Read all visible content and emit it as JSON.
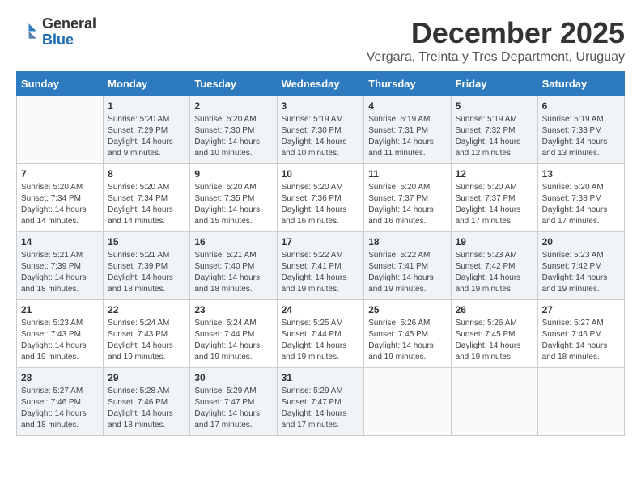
{
  "header": {
    "logo_general": "General",
    "logo_blue": "Blue",
    "month_title": "December 2025",
    "location": "Vergara, Treinta y Tres Department, Uruguay"
  },
  "weekdays": [
    "Sunday",
    "Monday",
    "Tuesday",
    "Wednesday",
    "Thursday",
    "Friday",
    "Saturday"
  ],
  "weeks": [
    [
      {
        "day": "",
        "sunrise": "",
        "sunset": "",
        "daylight": ""
      },
      {
        "day": "1",
        "sunrise": "Sunrise: 5:20 AM",
        "sunset": "Sunset: 7:29 PM",
        "daylight": "Daylight: 14 hours and 9 minutes."
      },
      {
        "day": "2",
        "sunrise": "Sunrise: 5:20 AM",
        "sunset": "Sunset: 7:30 PM",
        "daylight": "Daylight: 14 hours and 10 minutes."
      },
      {
        "day": "3",
        "sunrise": "Sunrise: 5:19 AM",
        "sunset": "Sunset: 7:30 PM",
        "daylight": "Daylight: 14 hours and 10 minutes."
      },
      {
        "day": "4",
        "sunrise": "Sunrise: 5:19 AM",
        "sunset": "Sunset: 7:31 PM",
        "daylight": "Daylight: 14 hours and 11 minutes."
      },
      {
        "day": "5",
        "sunrise": "Sunrise: 5:19 AM",
        "sunset": "Sunset: 7:32 PM",
        "daylight": "Daylight: 14 hours and 12 minutes."
      },
      {
        "day": "6",
        "sunrise": "Sunrise: 5:19 AM",
        "sunset": "Sunset: 7:33 PM",
        "daylight": "Daylight: 14 hours and 13 minutes."
      }
    ],
    [
      {
        "day": "7",
        "sunrise": "Sunrise: 5:20 AM",
        "sunset": "Sunset: 7:34 PM",
        "daylight": "Daylight: 14 hours and 14 minutes."
      },
      {
        "day": "8",
        "sunrise": "Sunrise: 5:20 AM",
        "sunset": "Sunset: 7:34 PM",
        "daylight": "Daylight: 14 hours and 14 minutes."
      },
      {
        "day": "9",
        "sunrise": "Sunrise: 5:20 AM",
        "sunset": "Sunset: 7:35 PM",
        "daylight": "Daylight: 14 hours and 15 minutes."
      },
      {
        "day": "10",
        "sunrise": "Sunrise: 5:20 AM",
        "sunset": "Sunset: 7:36 PM",
        "daylight": "Daylight: 14 hours and 16 minutes."
      },
      {
        "day": "11",
        "sunrise": "Sunrise: 5:20 AM",
        "sunset": "Sunset: 7:37 PM",
        "daylight": "Daylight: 14 hours and 16 minutes."
      },
      {
        "day": "12",
        "sunrise": "Sunrise: 5:20 AM",
        "sunset": "Sunset: 7:37 PM",
        "daylight": "Daylight: 14 hours and 17 minutes."
      },
      {
        "day": "13",
        "sunrise": "Sunrise: 5:20 AM",
        "sunset": "Sunset: 7:38 PM",
        "daylight": "Daylight: 14 hours and 17 minutes."
      }
    ],
    [
      {
        "day": "14",
        "sunrise": "Sunrise: 5:21 AM",
        "sunset": "Sunset: 7:39 PM",
        "daylight": "Daylight: 14 hours and 18 minutes."
      },
      {
        "day": "15",
        "sunrise": "Sunrise: 5:21 AM",
        "sunset": "Sunset: 7:39 PM",
        "daylight": "Daylight: 14 hours and 18 minutes."
      },
      {
        "day": "16",
        "sunrise": "Sunrise: 5:21 AM",
        "sunset": "Sunset: 7:40 PM",
        "daylight": "Daylight: 14 hours and 18 minutes."
      },
      {
        "day": "17",
        "sunrise": "Sunrise: 5:22 AM",
        "sunset": "Sunset: 7:41 PM",
        "daylight": "Daylight: 14 hours and 19 minutes."
      },
      {
        "day": "18",
        "sunrise": "Sunrise: 5:22 AM",
        "sunset": "Sunset: 7:41 PM",
        "daylight": "Daylight: 14 hours and 19 minutes."
      },
      {
        "day": "19",
        "sunrise": "Sunrise: 5:23 AM",
        "sunset": "Sunset: 7:42 PM",
        "daylight": "Daylight: 14 hours and 19 minutes."
      },
      {
        "day": "20",
        "sunrise": "Sunrise: 5:23 AM",
        "sunset": "Sunset: 7:42 PM",
        "daylight": "Daylight: 14 hours and 19 minutes."
      }
    ],
    [
      {
        "day": "21",
        "sunrise": "Sunrise: 5:23 AM",
        "sunset": "Sunset: 7:43 PM",
        "daylight": "Daylight: 14 hours and 19 minutes."
      },
      {
        "day": "22",
        "sunrise": "Sunrise: 5:24 AM",
        "sunset": "Sunset: 7:43 PM",
        "daylight": "Daylight: 14 hours and 19 minutes."
      },
      {
        "day": "23",
        "sunrise": "Sunrise: 5:24 AM",
        "sunset": "Sunset: 7:44 PM",
        "daylight": "Daylight: 14 hours and 19 minutes."
      },
      {
        "day": "24",
        "sunrise": "Sunrise: 5:25 AM",
        "sunset": "Sunset: 7:44 PM",
        "daylight": "Daylight: 14 hours and 19 minutes."
      },
      {
        "day": "25",
        "sunrise": "Sunrise: 5:26 AM",
        "sunset": "Sunset: 7:45 PM",
        "daylight": "Daylight: 14 hours and 19 minutes."
      },
      {
        "day": "26",
        "sunrise": "Sunrise: 5:26 AM",
        "sunset": "Sunset: 7:45 PM",
        "daylight": "Daylight: 14 hours and 19 minutes."
      },
      {
        "day": "27",
        "sunrise": "Sunrise: 5:27 AM",
        "sunset": "Sunset: 7:46 PM",
        "daylight": "Daylight: 14 hours and 18 minutes."
      }
    ],
    [
      {
        "day": "28",
        "sunrise": "Sunrise: 5:27 AM",
        "sunset": "Sunset: 7:46 PM",
        "daylight": "Daylight: 14 hours and 18 minutes."
      },
      {
        "day": "29",
        "sunrise": "Sunrise: 5:28 AM",
        "sunset": "Sunset: 7:46 PM",
        "daylight": "Daylight: 14 hours and 18 minutes."
      },
      {
        "day": "30",
        "sunrise": "Sunrise: 5:29 AM",
        "sunset": "Sunset: 7:47 PM",
        "daylight": "Daylight: 14 hours and 17 minutes."
      },
      {
        "day": "31",
        "sunrise": "Sunrise: 5:29 AM",
        "sunset": "Sunset: 7:47 PM",
        "daylight": "Daylight: 14 hours and 17 minutes."
      },
      {
        "day": "",
        "sunrise": "",
        "sunset": "",
        "daylight": ""
      },
      {
        "day": "",
        "sunrise": "",
        "sunset": "",
        "daylight": ""
      },
      {
        "day": "",
        "sunrise": "",
        "sunset": "",
        "daylight": ""
      }
    ]
  ]
}
